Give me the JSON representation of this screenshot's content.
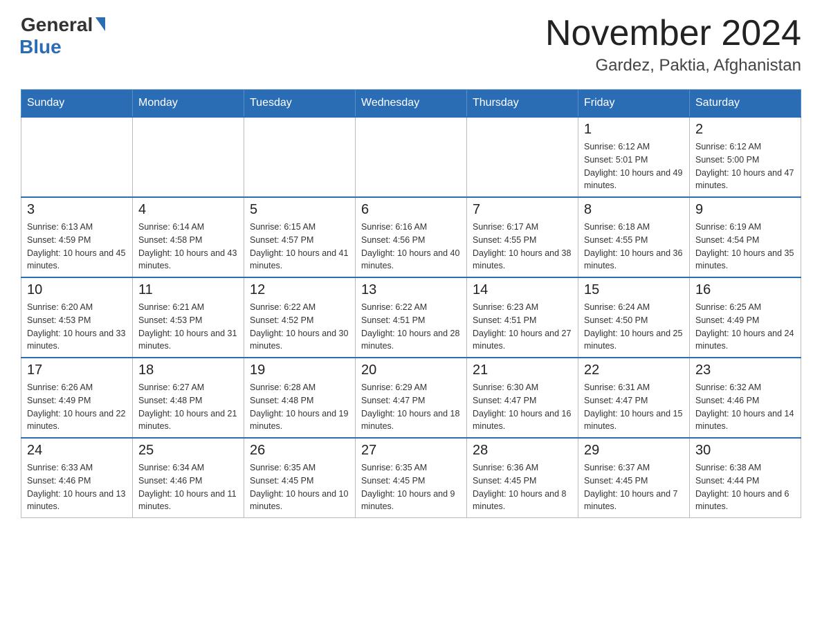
{
  "header": {
    "logo_general": "General",
    "logo_blue": "Blue",
    "month_title": "November 2024",
    "location": "Gardez, Paktia, Afghanistan"
  },
  "weekdays": [
    "Sunday",
    "Monday",
    "Tuesday",
    "Wednesday",
    "Thursday",
    "Friday",
    "Saturday"
  ],
  "weeks": [
    [
      {
        "day": "",
        "sunrise": "",
        "sunset": "",
        "daylight": ""
      },
      {
        "day": "",
        "sunrise": "",
        "sunset": "",
        "daylight": ""
      },
      {
        "day": "",
        "sunrise": "",
        "sunset": "",
        "daylight": ""
      },
      {
        "day": "",
        "sunrise": "",
        "sunset": "",
        "daylight": ""
      },
      {
        "day": "",
        "sunrise": "",
        "sunset": "",
        "daylight": ""
      },
      {
        "day": "1",
        "sunrise": "Sunrise: 6:12 AM",
        "sunset": "Sunset: 5:01 PM",
        "daylight": "Daylight: 10 hours and 49 minutes."
      },
      {
        "day": "2",
        "sunrise": "Sunrise: 6:12 AM",
        "sunset": "Sunset: 5:00 PM",
        "daylight": "Daylight: 10 hours and 47 minutes."
      }
    ],
    [
      {
        "day": "3",
        "sunrise": "Sunrise: 6:13 AM",
        "sunset": "Sunset: 4:59 PM",
        "daylight": "Daylight: 10 hours and 45 minutes."
      },
      {
        "day": "4",
        "sunrise": "Sunrise: 6:14 AM",
        "sunset": "Sunset: 4:58 PM",
        "daylight": "Daylight: 10 hours and 43 minutes."
      },
      {
        "day": "5",
        "sunrise": "Sunrise: 6:15 AM",
        "sunset": "Sunset: 4:57 PM",
        "daylight": "Daylight: 10 hours and 41 minutes."
      },
      {
        "day": "6",
        "sunrise": "Sunrise: 6:16 AM",
        "sunset": "Sunset: 4:56 PM",
        "daylight": "Daylight: 10 hours and 40 minutes."
      },
      {
        "day": "7",
        "sunrise": "Sunrise: 6:17 AM",
        "sunset": "Sunset: 4:55 PM",
        "daylight": "Daylight: 10 hours and 38 minutes."
      },
      {
        "day": "8",
        "sunrise": "Sunrise: 6:18 AM",
        "sunset": "Sunset: 4:55 PM",
        "daylight": "Daylight: 10 hours and 36 minutes."
      },
      {
        "day": "9",
        "sunrise": "Sunrise: 6:19 AM",
        "sunset": "Sunset: 4:54 PM",
        "daylight": "Daylight: 10 hours and 35 minutes."
      }
    ],
    [
      {
        "day": "10",
        "sunrise": "Sunrise: 6:20 AM",
        "sunset": "Sunset: 4:53 PM",
        "daylight": "Daylight: 10 hours and 33 minutes."
      },
      {
        "day": "11",
        "sunrise": "Sunrise: 6:21 AM",
        "sunset": "Sunset: 4:53 PM",
        "daylight": "Daylight: 10 hours and 31 minutes."
      },
      {
        "day": "12",
        "sunrise": "Sunrise: 6:22 AM",
        "sunset": "Sunset: 4:52 PM",
        "daylight": "Daylight: 10 hours and 30 minutes."
      },
      {
        "day": "13",
        "sunrise": "Sunrise: 6:22 AM",
        "sunset": "Sunset: 4:51 PM",
        "daylight": "Daylight: 10 hours and 28 minutes."
      },
      {
        "day": "14",
        "sunrise": "Sunrise: 6:23 AM",
        "sunset": "Sunset: 4:51 PM",
        "daylight": "Daylight: 10 hours and 27 minutes."
      },
      {
        "day": "15",
        "sunrise": "Sunrise: 6:24 AM",
        "sunset": "Sunset: 4:50 PM",
        "daylight": "Daylight: 10 hours and 25 minutes."
      },
      {
        "day": "16",
        "sunrise": "Sunrise: 6:25 AM",
        "sunset": "Sunset: 4:49 PM",
        "daylight": "Daylight: 10 hours and 24 minutes."
      }
    ],
    [
      {
        "day": "17",
        "sunrise": "Sunrise: 6:26 AM",
        "sunset": "Sunset: 4:49 PM",
        "daylight": "Daylight: 10 hours and 22 minutes."
      },
      {
        "day": "18",
        "sunrise": "Sunrise: 6:27 AM",
        "sunset": "Sunset: 4:48 PM",
        "daylight": "Daylight: 10 hours and 21 minutes."
      },
      {
        "day": "19",
        "sunrise": "Sunrise: 6:28 AM",
        "sunset": "Sunset: 4:48 PM",
        "daylight": "Daylight: 10 hours and 19 minutes."
      },
      {
        "day": "20",
        "sunrise": "Sunrise: 6:29 AM",
        "sunset": "Sunset: 4:47 PM",
        "daylight": "Daylight: 10 hours and 18 minutes."
      },
      {
        "day": "21",
        "sunrise": "Sunrise: 6:30 AM",
        "sunset": "Sunset: 4:47 PM",
        "daylight": "Daylight: 10 hours and 16 minutes."
      },
      {
        "day": "22",
        "sunrise": "Sunrise: 6:31 AM",
        "sunset": "Sunset: 4:47 PM",
        "daylight": "Daylight: 10 hours and 15 minutes."
      },
      {
        "day": "23",
        "sunrise": "Sunrise: 6:32 AM",
        "sunset": "Sunset: 4:46 PM",
        "daylight": "Daylight: 10 hours and 14 minutes."
      }
    ],
    [
      {
        "day": "24",
        "sunrise": "Sunrise: 6:33 AM",
        "sunset": "Sunset: 4:46 PM",
        "daylight": "Daylight: 10 hours and 13 minutes."
      },
      {
        "day": "25",
        "sunrise": "Sunrise: 6:34 AM",
        "sunset": "Sunset: 4:46 PM",
        "daylight": "Daylight: 10 hours and 11 minutes."
      },
      {
        "day": "26",
        "sunrise": "Sunrise: 6:35 AM",
        "sunset": "Sunset: 4:45 PM",
        "daylight": "Daylight: 10 hours and 10 minutes."
      },
      {
        "day": "27",
        "sunrise": "Sunrise: 6:35 AM",
        "sunset": "Sunset: 4:45 PM",
        "daylight": "Daylight: 10 hours and 9 minutes."
      },
      {
        "day": "28",
        "sunrise": "Sunrise: 6:36 AM",
        "sunset": "Sunset: 4:45 PM",
        "daylight": "Daylight: 10 hours and 8 minutes."
      },
      {
        "day": "29",
        "sunrise": "Sunrise: 6:37 AM",
        "sunset": "Sunset: 4:45 PM",
        "daylight": "Daylight: 10 hours and 7 minutes."
      },
      {
        "day": "30",
        "sunrise": "Sunrise: 6:38 AM",
        "sunset": "Sunset: 4:44 PM",
        "daylight": "Daylight: 10 hours and 6 minutes."
      }
    ]
  ]
}
